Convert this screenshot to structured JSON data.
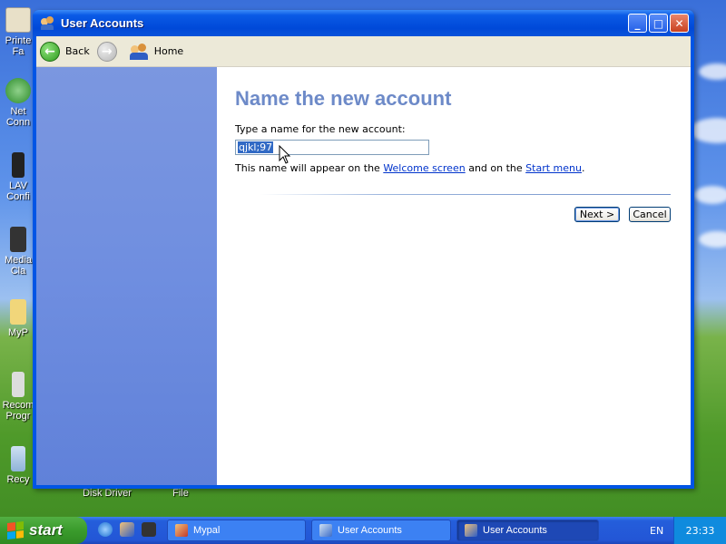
{
  "desktop": {
    "icons": [
      {
        "label": "Printe\nFa",
        "icon": "printer-icon"
      },
      {
        "label": "Net\nConn",
        "icon": "network-icon"
      },
      {
        "label": "LAV\nConfi",
        "icon": "config-icon"
      },
      {
        "label": "Media\nCla",
        "icon": "media-icon"
      },
      {
        "label": "MyP",
        "icon": "folder-icon"
      },
      {
        "label": "Recom\nProgr",
        "icon": "program-icon"
      },
      {
        "label": "Recy",
        "icon": "recycle-bin-icon"
      },
      {
        "label": "Disk Driver",
        "icon": "disk-icon"
      },
      {
        "label": "File",
        "icon": "file-icon"
      }
    ]
  },
  "window": {
    "title": "User Accounts",
    "buttons": {
      "minimize": "_",
      "maximize": "□",
      "close": "✕"
    }
  },
  "toolbar": {
    "back_label": "Back",
    "home_label": "Home"
  },
  "main": {
    "heading": "Name the new account",
    "prompt": "Type a name for the new account:",
    "input_value": "qjkl;97",
    "note_prefix": "This name will appear on the",
    "note_link1": "Welcome screen",
    "note_mid": "and on the",
    "note_link2": "Start menu",
    "note_suffix": ".",
    "next_label": "Next >",
    "cancel_label": "Cancel"
  },
  "taskbar": {
    "start_label": "start",
    "tasks": [
      {
        "label": "Mypal",
        "active": false
      },
      {
        "label": "User Accounts",
        "active": false
      },
      {
        "label": "User Accounts",
        "active": true
      }
    ],
    "language": "EN",
    "clock": "23:33"
  },
  "colors": {
    "title_bar": "#0a5ae6",
    "heading": "#6d8ac8",
    "side_panel": "#6f8ee0",
    "selection": "#316ac5",
    "link": "#0033cc",
    "start_button": "#3a9b2c",
    "taskbar": "#245edb"
  }
}
